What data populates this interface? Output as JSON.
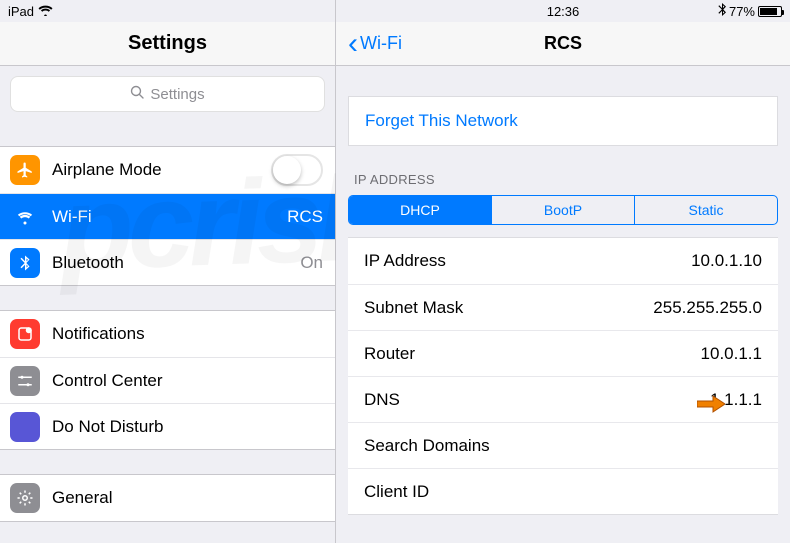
{
  "statusbar": {
    "device": "iPad",
    "time": "12:36",
    "battery_pct": "77%"
  },
  "left": {
    "title": "Settings",
    "search_placeholder": "Settings",
    "groups": [
      {
        "items": [
          {
            "id": "airplane",
            "label": "Airplane Mode",
            "icon": "airplane",
            "color": "#ff9500",
            "control": "switch",
            "switch_on": false
          },
          {
            "id": "wifi",
            "label": "Wi-Fi",
            "icon": "wifi",
            "color": "#007aff",
            "value": "RCS",
            "selected": true
          },
          {
            "id": "bluetooth",
            "label": "Bluetooth",
            "icon": "bluetooth",
            "color": "#007aff",
            "value": "On"
          }
        ]
      },
      {
        "items": [
          {
            "id": "notifications",
            "label": "Notifications",
            "icon": "notifications",
            "color": "#ff3b30"
          },
          {
            "id": "controlcenter",
            "label": "Control Center",
            "icon": "controlcenter",
            "color": "#8e8e93"
          },
          {
            "id": "dnd",
            "label": "Do Not Disturb",
            "icon": "moon",
            "color": "#5856d6"
          }
        ]
      },
      {
        "items": [
          {
            "id": "general",
            "label": "General",
            "icon": "gear",
            "color": "#8e8e93"
          }
        ]
      }
    ]
  },
  "right": {
    "back_label": "Wi-Fi",
    "title": "RCS",
    "forget_label": "Forget This Network",
    "ip_section_label": "IP ADDRESS",
    "segments": [
      "DHCP",
      "BootP",
      "Static"
    ],
    "segment_active": 0,
    "fields": [
      {
        "label": "IP Address",
        "value": "10.0.1.10"
      },
      {
        "label": "Subnet Mask",
        "value": "255.255.255.0"
      },
      {
        "label": "Router",
        "value": "10.0.1.1"
      },
      {
        "label": "DNS",
        "value": "1.1.1.1",
        "highlight": true
      },
      {
        "label": "Search Domains",
        "value": ""
      },
      {
        "label": "Client ID",
        "value": ""
      }
    ]
  },
  "watermark": "pcrisk.com"
}
